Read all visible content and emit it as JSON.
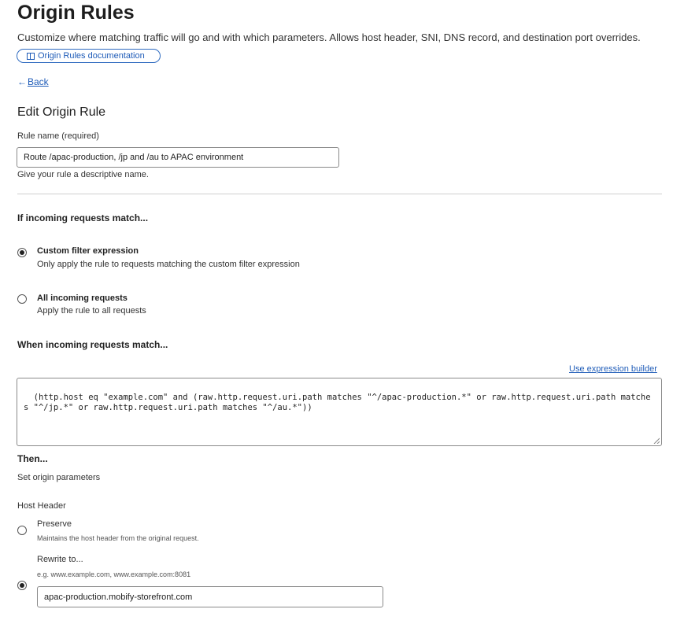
{
  "header": {
    "title": "Origin Rules",
    "subtitle": "Customize where matching traffic will go and with which parameters. Allows host header, SNI, DNS record, and destination port overrides.",
    "doc_link": "Origin Rules documentation",
    "back": "Back"
  },
  "form": {
    "heading": "Edit Origin Rule",
    "rule_name_label": "Rule name (required)",
    "rule_name_value": "Route /apac-production, /jp and /au to APAC environment",
    "rule_name_help": "Give your rule a descriptive name."
  },
  "match": {
    "heading": "If incoming requests match...",
    "options": [
      {
        "title": "Custom filter expression",
        "desc": "Only apply the rule to requests matching the custom filter expression",
        "selected": true
      },
      {
        "title": "All incoming requests",
        "desc": "Apply the rule to all requests",
        "selected": false
      }
    ],
    "expression_heading": "When incoming requests match...",
    "expression_builder_link": "Use expression builder",
    "expression": "(http.host eq \"example.com\" and (raw.http.request.uri.path matches \"^/apac-production.*\" or raw.http.request.uri.path matches \"^/jp.*\" or raw.http.request.uri.path matches \"^/au.*\"))"
  },
  "then": {
    "heading": "Then...",
    "subheading": "Set origin parameters",
    "host_header_label": "Host Header",
    "preserve_title": "Preserve",
    "preserve_desc": "Maintains the host header from the original request.",
    "rewrite_title": "Rewrite to...",
    "rewrite_hint": "e.g. www.example.com, www.example.com:8081",
    "rewrite_value": "apac-production.mobify-storefront.com"
  }
}
